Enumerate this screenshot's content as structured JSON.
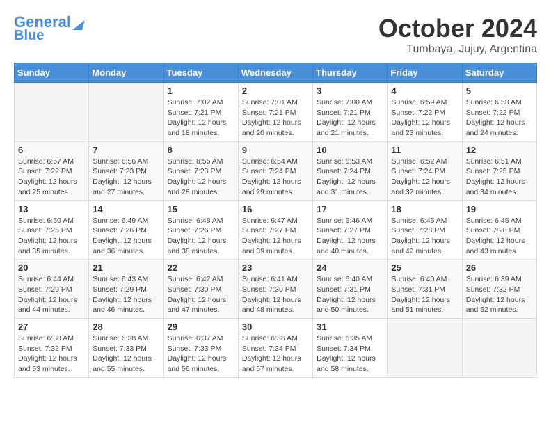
{
  "header": {
    "logo_line1": "General",
    "logo_line2": "Blue",
    "month": "October 2024",
    "location": "Tumbaya, Jujuy, Argentina"
  },
  "weekdays": [
    "Sunday",
    "Monday",
    "Tuesday",
    "Wednesday",
    "Thursday",
    "Friday",
    "Saturday"
  ],
  "weeks": [
    [
      {
        "day": "",
        "info": ""
      },
      {
        "day": "",
        "info": ""
      },
      {
        "day": "1",
        "info": "Sunrise: 7:02 AM\nSunset: 7:21 PM\nDaylight: 12 hours and 18 minutes."
      },
      {
        "day": "2",
        "info": "Sunrise: 7:01 AM\nSunset: 7:21 PM\nDaylight: 12 hours and 20 minutes."
      },
      {
        "day": "3",
        "info": "Sunrise: 7:00 AM\nSunset: 7:21 PM\nDaylight: 12 hours and 21 minutes."
      },
      {
        "day": "4",
        "info": "Sunrise: 6:59 AM\nSunset: 7:22 PM\nDaylight: 12 hours and 23 minutes."
      },
      {
        "day": "5",
        "info": "Sunrise: 6:58 AM\nSunset: 7:22 PM\nDaylight: 12 hours and 24 minutes."
      }
    ],
    [
      {
        "day": "6",
        "info": "Sunrise: 6:57 AM\nSunset: 7:22 PM\nDaylight: 12 hours and 25 minutes."
      },
      {
        "day": "7",
        "info": "Sunrise: 6:56 AM\nSunset: 7:23 PM\nDaylight: 12 hours and 27 minutes."
      },
      {
        "day": "8",
        "info": "Sunrise: 6:55 AM\nSunset: 7:23 PM\nDaylight: 12 hours and 28 minutes."
      },
      {
        "day": "9",
        "info": "Sunrise: 6:54 AM\nSunset: 7:24 PM\nDaylight: 12 hours and 29 minutes."
      },
      {
        "day": "10",
        "info": "Sunrise: 6:53 AM\nSunset: 7:24 PM\nDaylight: 12 hours and 31 minutes."
      },
      {
        "day": "11",
        "info": "Sunrise: 6:52 AM\nSunset: 7:24 PM\nDaylight: 12 hours and 32 minutes."
      },
      {
        "day": "12",
        "info": "Sunrise: 6:51 AM\nSunset: 7:25 PM\nDaylight: 12 hours and 34 minutes."
      }
    ],
    [
      {
        "day": "13",
        "info": "Sunrise: 6:50 AM\nSunset: 7:25 PM\nDaylight: 12 hours and 35 minutes."
      },
      {
        "day": "14",
        "info": "Sunrise: 6:49 AM\nSunset: 7:26 PM\nDaylight: 12 hours and 36 minutes."
      },
      {
        "day": "15",
        "info": "Sunrise: 6:48 AM\nSunset: 7:26 PM\nDaylight: 12 hours and 38 minutes."
      },
      {
        "day": "16",
        "info": "Sunrise: 6:47 AM\nSunset: 7:27 PM\nDaylight: 12 hours and 39 minutes."
      },
      {
        "day": "17",
        "info": "Sunrise: 6:46 AM\nSunset: 7:27 PM\nDaylight: 12 hours and 40 minutes."
      },
      {
        "day": "18",
        "info": "Sunrise: 6:45 AM\nSunset: 7:28 PM\nDaylight: 12 hours and 42 minutes."
      },
      {
        "day": "19",
        "info": "Sunrise: 6:45 AM\nSunset: 7:28 PM\nDaylight: 12 hours and 43 minutes."
      }
    ],
    [
      {
        "day": "20",
        "info": "Sunrise: 6:44 AM\nSunset: 7:29 PM\nDaylight: 12 hours and 44 minutes."
      },
      {
        "day": "21",
        "info": "Sunrise: 6:43 AM\nSunset: 7:29 PM\nDaylight: 12 hours and 46 minutes."
      },
      {
        "day": "22",
        "info": "Sunrise: 6:42 AM\nSunset: 7:30 PM\nDaylight: 12 hours and 47 minutes."
      },
      {
        "day": "23",
        "info": "Sunrise: 6:41 AM\nSunset: 7:30 PM\nDaylight: 12 hours and 48 minutes."
      },
      {
        "day": "24",
        "info": "Sunrise: 6:40 AM\nSunset: 7:31 PM\nDaylight: 12 hours and 50 minutes."
      },
      {
        "day": "25",
        "info": "Sunrise: 6:40 AM\nSunset: 7:31 PM\nDaylight: 12 hours and 51 minutes."
      },
      {
        "day": "26",
        "info": "Sunrise: 6:39 AM\nSunset: 7:32 PM\nDaylight: 12 hours and 52 minutes."
      }
    ],
    [
      {
        "day": "27",
        "info": "Sunrise: 6:38 AM\nSunset: 7:32 PM\nDaylight: 12 hours and 53 minutes."
      },
      {
        "day": "28",
        "info": "Sunrise: 6:38 AM\nSunset: 7:33 PM\nDaylight: 12 hours and 55 minutes."
      },
      {
        "day": "29",
        "info": "Sunrise: 6:37 AM\nSunset: 7:33 PM\nDaylight: 12 hours and 56 minutes."
      },
      {
        "day": "30",
        "info": "Sunrise: 6:36 AM\nSunset: 7:34 PM\nDaylight: 12 hours and 57 minutes."
      },
      {
        "day": "31",
        "info": "Sunrise: 6:35 AM\nSunset: 7:34 PM\nDaylight: 12 hours and 58 minutes."
      },
      {
        "day": "",
        "info": ""
      },
      {
        "day": "",
        "info": ""
      }
    ]
  ]
}
